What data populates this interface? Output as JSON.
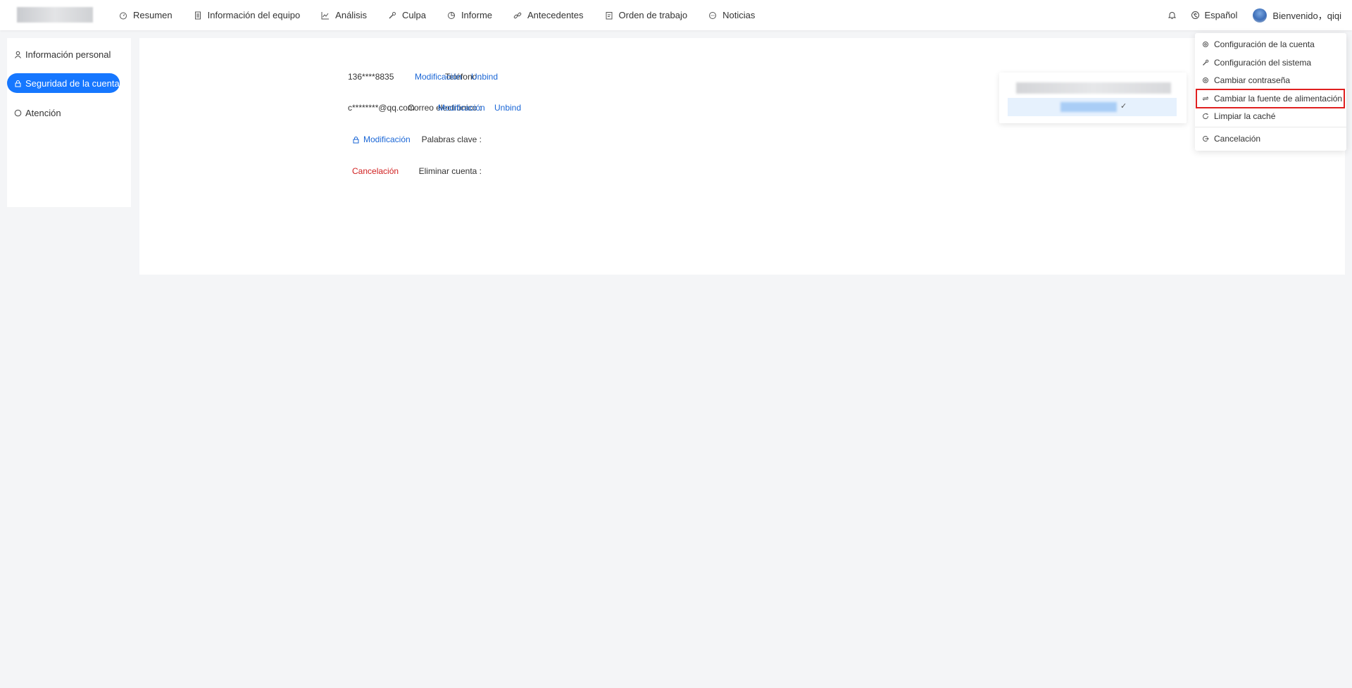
{
  "header": {
    "nav": [
      {
        "label": "Resumen",
        "icon": "dashboard-icon"
      },
      {
        "label": "Información del equipo",
        "icon": "document-icon"
      },
      {
        "label": "Análisis",
        "icon": "line-chart-icon"
      },
      {
        "label": "Culpa",
        "icon": "wrench-icon"
      },
      {
        "label": "Informe",
        "icon": "pie-chart-icon"
      },
      {
        "label": "Antecedentes",
        "icon": "link-icon"
      },
      {
        "label": "Orden de trabajo",
        "icon": "clipboard-icon"
      },
      {
        "label": "Noticias",
        "icon": "message-icon"
      }
    ],
    "language": "Español",
    "greeting": "Bienvenido，qiqi"
  },
  "sidebar": {
    "items": [
      {
        "label": "Información personal",
        "icon": "user-icon"
      },
      {
        "label": "Seguridad de la cuenta",
        "icon": "lock-icon",
        "active": true
      },
      {
        "label": "Atención",
        "icon": "circle-icon"
      }
    ]
  },
  "security": {
    "phone_label": "Teléfono :",
    "phone_value": "136****8835",
    "email_label": "Correo electrónico :",
    "email_value": "c********@qq.com",
    "password_label": "Palabras clave :",
    "delete_label": "Eliminar cuenta :",
    "modify_link": "Modificación",
    "unbind_link": "Unbind",
    "cancel_link": "Cancelación"
  },
  "language_panel": {
    "check": "✓"
  },
  "user_menu": {
    "items": [
      {
        "label": "Configuración de la cuenta",
        "icon": "gear-icon"
      },
      {
        "label": "Configuración del sistema",
        "icon": "wrench-icon"
      },
      {
        "label": "Cambiar contraseña",
        "icon": "gear-icon"
      },
      {
        "label": "Cambiar la fuente de alimentación",
        "icon": "swap-icon",
        "highlighted": true
      },
      {
        "label": "Limpiar la caché",
        "icon": "refresh-icon"
      },
      {
        "label": "Cancelación",
        "icon": "logout-icon"
      }
    ]
  },
  "colors": {
    "accent": "#1677ff",
    "link": "#1a66d6",
    "danger": "#d01f1f",
    "highlight_border": "#e02020",
    "background": "#f4f5f7"
  }
}
